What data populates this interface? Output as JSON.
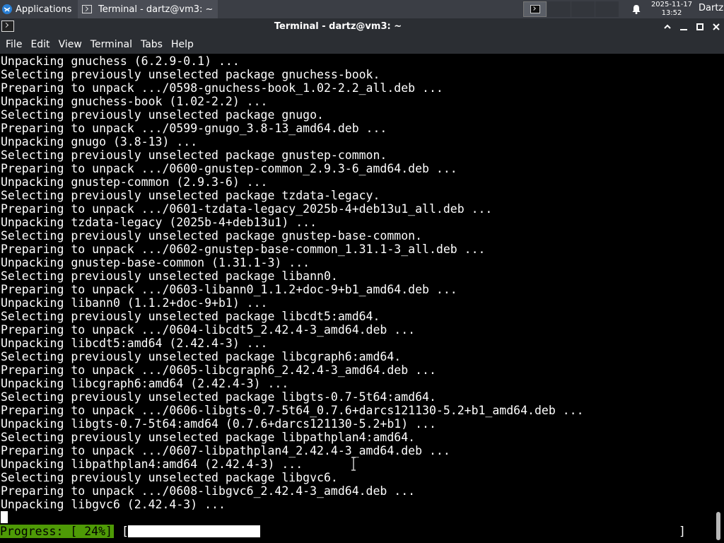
{
  "panel": {
    "applications_label": "Applications",
    "task_label": "Terminal - dartz@vm3: ~",
    "clock_date": "2025-11-17",
    "clock_time": "13:52",
    "user": "Dartz"
  },
  "window": {
    "title": "Terminal - dartz@vm3: ~"
  },
  "menu": [
    "File",
    "Edit",
    "View",
    "Terminal",
    "Tabs",
    "Help"
  ],
  "terminal": {
    "lines": [
      "Unpacking gnuchess (6.2.9-0.1) ...",
      "Selecting previously unselected package gnuchess-book.",
      "Preparing to unpack .../0598-gnuchess-book_1.02-2.2_all.deb ...",
      "Unpacking gnuchess-book (1.02-2.2) ...",
      "Selecting previously unselected package gnugo.",
      "Preparing to unpack .../0599-gnugo_3.8-13_amd64.deb ...",
      "Unpacking gnugo (3.8-13) ...",
      "Selecting previously unselected package gnustep-common.",
      "Preparing to unpack .../0600-gnustep-common_2.9.3-6_amd64.deb ...",
      "Unpacking gnustep-common (2.9.3-6) ...",
      "Selecting previously unselected package tzdata-legacy.",
      "Preparing to unpack .../0601-tzdata-legacy_2025b-4+deb13u1_all.deb ...",
      "Unpacking tzdata-legacy (2025b-4+deb13u1) ...",
      "Selecting previously unselected package gnustep-base-common.",
      "Preparing to unpack .../0602-gnustep-base-common_1.31.1-3_all.deb ...",
      "Unpacking gnustep-base-common (1.31.1-3) ...",
      "Selecting previously unselected package libann0.",
      "Preparing to unpack .../0603-libann0_1.1.2+doc-9+b1_amd64.deb ...",
      "Unpacking libann0 (1.1.2+doc-9+b1) ...",
      "Selecting previously unselected package libcdt5:amd64.",
      "Preparing to unpack .../0604-libcdt5_2.42.4-3_amd64.deb ...",
      "Unpacking libcdt5:amd64 (2.42.4-3) ...",
      "Selecting previously unselected package libcgraph6:amd64.",
      "Preparing to unpack .../0605-libcgraph6_2.42.4-3_amd64.deb ...",
      "Unpacking libcgraph6:amd64 (2.42.4-3) ...",
      "Selecting previously unselected package libgts-0.7-5t64:amd64.",
      "Preparing to unpack .../0606-libgts-0.7-5t64_0.7.6+darcs121130-5.2+b1_amd64.deb ...",
      "Unpacking libgts-0.7-5t64:amd64 (0.7.6+darcs121130-5.2+b1) ...",
      "Selecting previously unselected package libpathplan4:amd64.",
      "Preparing to unpack .../0607-libpathplan4_2.42.4-3_amd64.deb ...",
      "Unpacking libpathplan4:amd64 (2.42.4-3) ...",
      "Selecting previously unselected package libgvc6.",
      "Preparing to unpack .../0608-libgvc6_2.42.4-3_amd64.deb ...",
      "Unpacking libgvc6 (2.42.4-3) ..."
    ],
    "progress_label": "Progress: [ 24%]",
    "progress_fraction": 0.24
  },
  "colors": {
    "progress_bg": "#4e9a06",
    "panel_bg": "#3b3e45",
    "titlebar_bg": "#2b2e33"
  }
}
